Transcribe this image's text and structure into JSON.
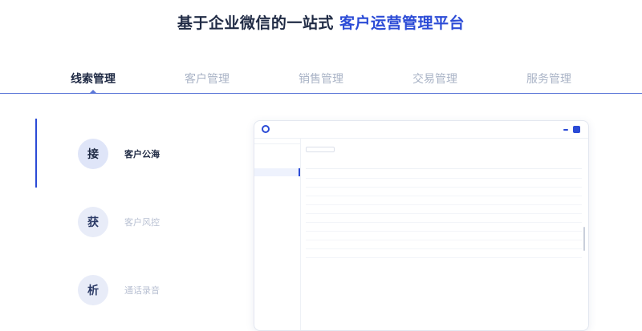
{
  "hero": {
    "title_plain": "基于企业微信的一站式 ",
    "title_accent": "客户运营管理平台"
  },
  "tabs": [
    {
      "label": "线索管理",
      "active": true
    },
    {
      "label": "客户管理",
      "active": false
    },
    {
      "label": "销售管理",
      "active": false
    },
    {
      "label": "交易管理",
      "active": false
    },
    {
      "label": "服务管理",
      "active": false
    }
  ],
  "features": [
    {
      "badge": "接",
      "label": "客户公海",
      "active": true
    },
    {
      "badge": "获",
      "label": "客户风控",
      "active": false
    },
    {
      "badge": "析",
      "label": "通话录音",
      "active": false
    }
  ],
  "colors": {
    "accent": "#2b4bd6",
    "text_dark": "#1f2a44",
    "text_muted": "#a9b3c6"
  }
}
